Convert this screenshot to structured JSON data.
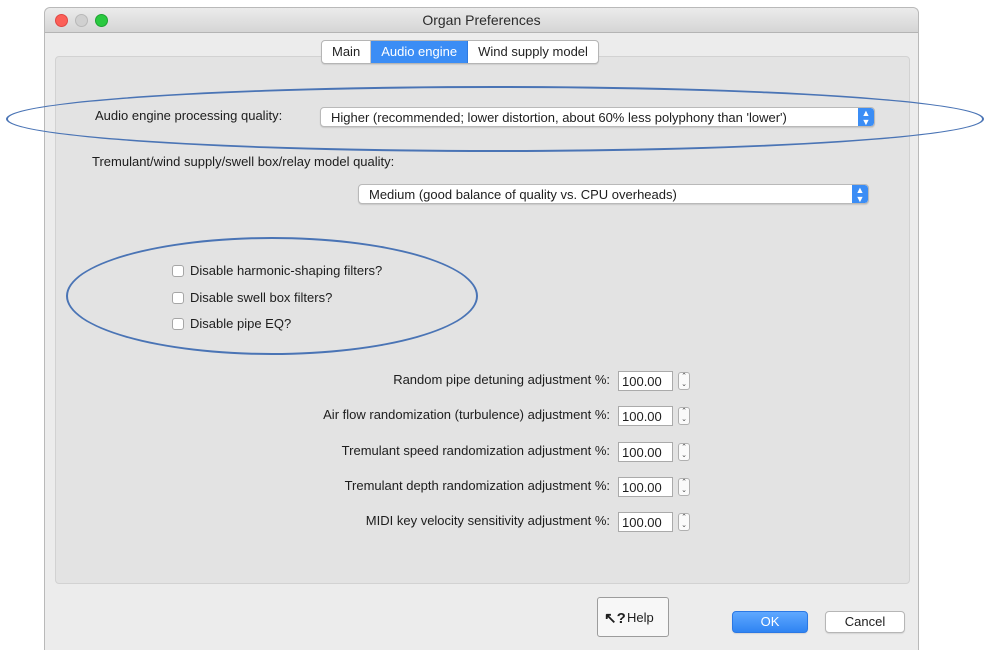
{
  "window": {
    "title": "Organ Preferences"
  },
  "tabs": [
    {
      "label": "Main",
      "active": false
    },
    {
      "label": "Audio engine",
      "active": true
    },
    {
      "label": "Wind supply model",
      "active": false
    }
  ],
  "audio_quality": {
    "label": "Audio engine processing quality:",
    "value": "Higher (recommended; lower distortion, about 60% less polyphony than 'lower')"
  },
  "model_quality": {
    "label": "Tremulant/wind supply/swell box/relay model quality:",
    "value": "Medium (good balance of quality vs. CPU overheads)"
  },
  "checkboxes": [
    {
      "label": "Disable harmonic-shaping filters?",
      "checked": false
    },
    {
      "label": "Disable swell box filters?",
      "checked": false
    },
    {
      "label": "Disable pipe EQ?",
      "checked": false
    }
  ],
  "adjustments": [
    {
      "label": "Random pipe detuning adjustment %:",
      "value": "100.00"
    },
    {
      "label": "Air flow randomization (turbulence) adjustment %:",
      "value": "100.00"
    },
    {
      "label": "Tremulant speed randomization adjustment %:",
      "value": "100.00"
    },
    {
      "label": "Tremulant depth randomization adjustment %:",
      "value": "100.00"
    },
    {
      "label": "MIDI key velocity sensitivity adjustment %:",
      "value": "100.00"
    }
  ],
  "buttons": {
    "help": "Help",
    "ok": "OK",
    "cancel": "Cancel"
  },
  "colors": {
    "accent": "#3b8df5",
    "annotation": "#4a74b5"
  }
}
